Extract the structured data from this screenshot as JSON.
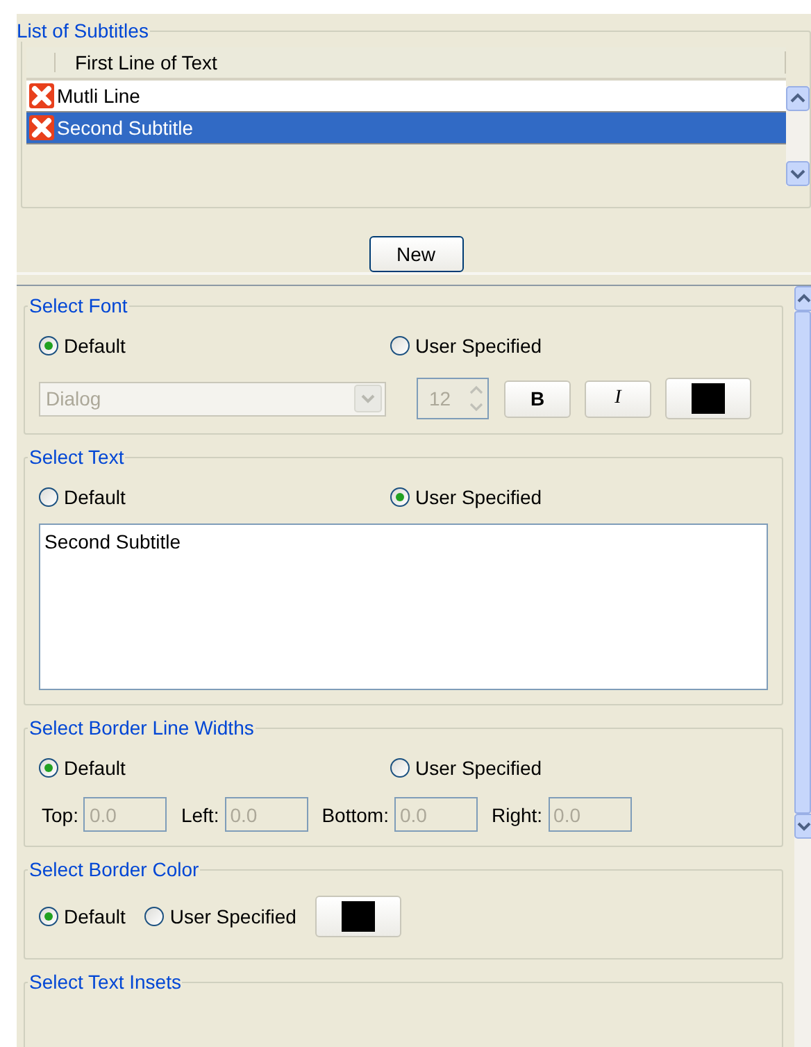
{
  "subtitles": {
    "title": "List of Subtitles",
    "column": "First Line of Text",
    "new_button": "New",
    "rows": [
      {
        "text": "Mutli Line",
        "selected": false
      },
      {
        "text": "Second Subtitle",
        "selected": true
      }
    ]
  },
  "sections": [
    {
      "kind": "font",
      "title": "Select Font",
      "disabled": true,
      "options": [
        {
          "label": "Default",
          "selected": true
        },
        {
          "label": "User Specified",
          "selected": false
        }
      ],
      "font": "Dialog",
      "size": "12",
      "bold": "B",
      "italic": "I",
      "color": "#000000"
    },
    {
      "kind": "text",
      "title": "Select Text",
      "options": [
        {
          "label": "Default",
          "selected": false
        },
        {
          "label": "User Specified",
          "selected": true
        }
      ],
      "text": "Second Subtitle"
    },
    {
      "kind": "widths",
      "title": "Select Border Line Widths",
      "disabled": true,
      "options": [
        {
          "label": "Default",
          "selected": true
        },
        {
          "label": "User Specified",
          "selected": false
        }
      ],
      "fields": [
        {
          "label": "Top:",
          "value": "0.0"
        },
        {
          "label": "Left:",
          "value": "0.0"
        },
        {
          "label": "Bottom:",
          "value": "0.0"
        },
        {
          "label": "Right:",
          "value": "0.0"
        }
      ]
    },
    {
      "kind": "color",
      "title": "Select Border Color",
      "options": [
        {
          "label": "Default",
          "selected": true
        },
        {
          "label": "User Specified",
          "selected": false
        }
      ],
      "color": "#000000"
    },
    {
      "kind": "insets",
      "title": "Select Text Insets"
    }
  ]
}
